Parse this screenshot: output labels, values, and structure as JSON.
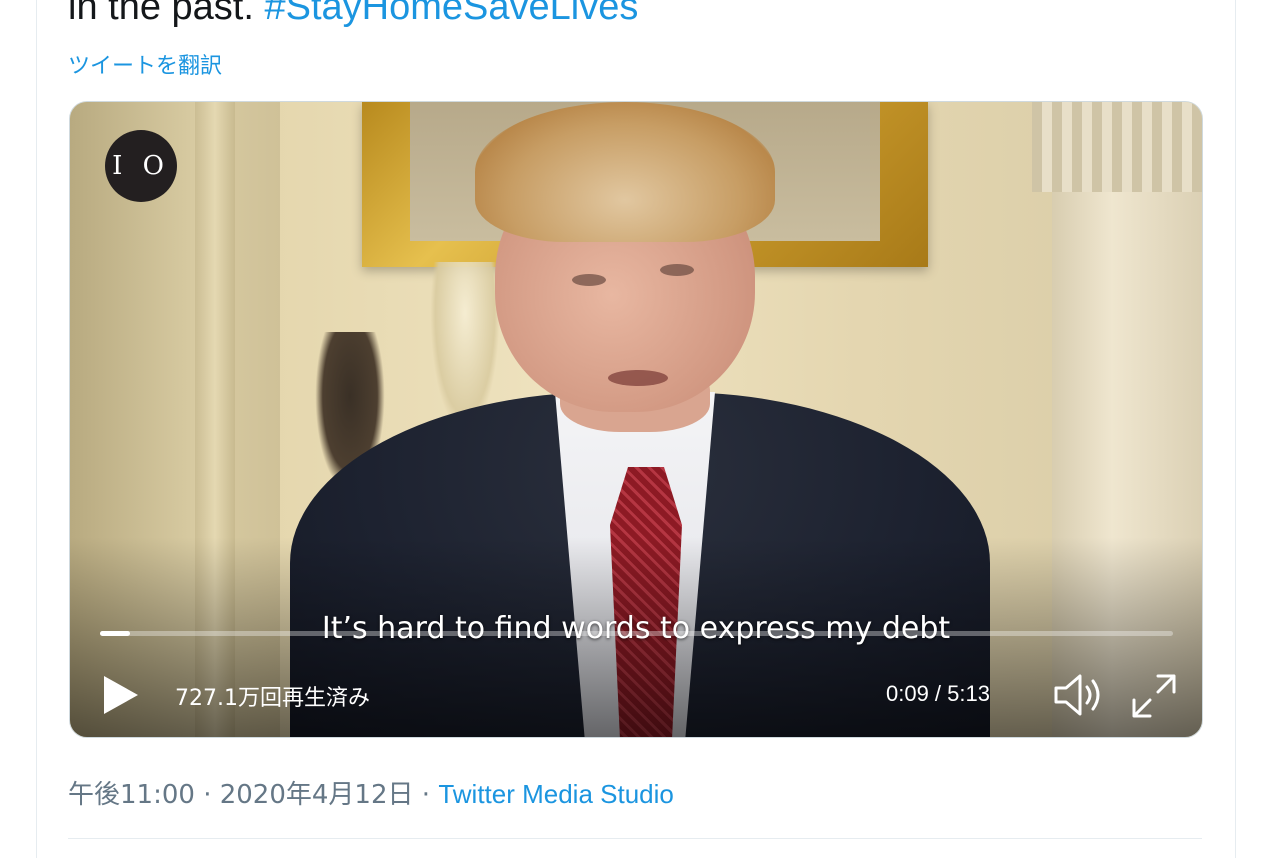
{
  "tweet": {
    "text_prefix": "in the past. ",
    "hashtag": "#StayHomeSaveLives",
    "translate_label": "ツイートを翻訳"
  },
  "video": {
    "logo_text": "I O",
    "caption": "It’s hard to find words to express my debt",
    "progress_fraction": 0.028,
    "view_count": "727.1万回再生済み",
    "time": "0:09 / 5:13"
  },
  "meta": {
    "time_date": "午後11:00 · 2020年4月12日 · ",
    "source": "Twitter Media Studio"
  },
  "colors": {
    "link": "#1b95e0",
    "text": "#14171a",
    "muted": "#657786"
  },
  "icons": [
    "play-icon",
    "volume-icon",
    "fullscreen-icon"
  ]
}
